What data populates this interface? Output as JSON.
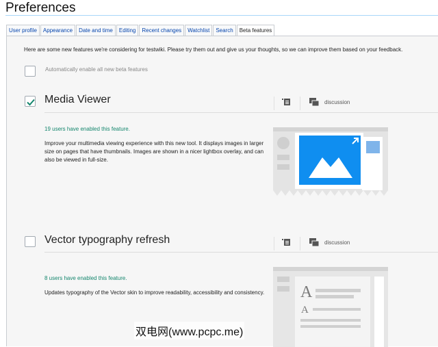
{
  "page": {
    "title": "Preferences"
  },
  "tabs": [
    {
      "label": "User profile",
      "active": false
    },
    {
      "label": "Appearance",
      "active": false
    },
    {
      "label": "Date and time",
      "active": false
    },
    {
      "label": "Editing",
      "active": false
    },
    {
      "label": "Recent changes",
      "active": false
    },
    {
      "label": "Watchlist",
      "active": false
    },
    {
      "label": "Search",
      "active": false
    },
    {
      "label": "Beta features",
      "active": true
    }
  ],
  "intro": "Here are some new features we're considering for testwiki. Please try them out and give us your thoughts, so we can improve them based on your feedback.",
  "auto_enable": {
    "label": "Automatically enable all new beta features",
    "checked": false
  },
  "features": [
    {
      "title": "Media Viewer",
      "checked": true,
      "discussion_label": "discussion",
      "count_text": "19 users have enabled this feature.",
      "description": "Improve your multimedia viewing experience with this new tool. It displays images in larger size on pages that have thumbnails. Images are shown in a nicer lightbox overlay, and can also be viewed in full-size."
    },
    {
      "title": "Vector typography refresh",
      "checked": false,
      "discussion_label": "discussion",
      "count_text": "8 users have enabled this feature.",
      "description": "Updates typography of the Vector skin to improve readability, accessibility and consistency."
    }
  ],
  "watermark": "双电网(www.pcpc.me)",
  "colors": {
    "accent": "#36c",
    "check": "#14866d",
    "link": "#0645ad",
    "image_blue": "#0f8ef0"
  }
}
